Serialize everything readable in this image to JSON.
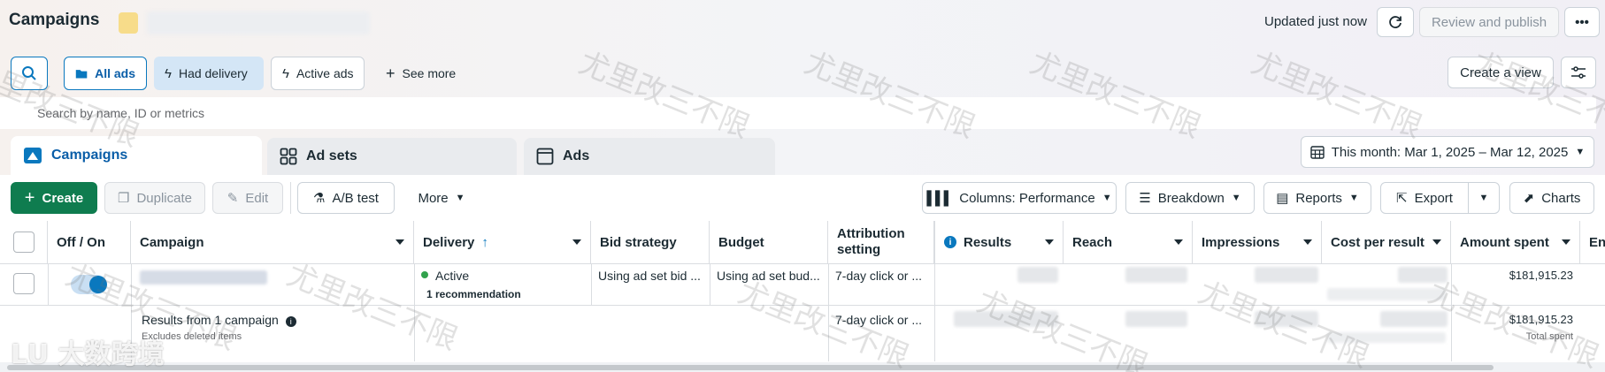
{
  "header": {
    "title": "Campaigns",
    "updated": "Updated just now",
    "review_label": "Review and publish",
    "more_icon": "ellipsis-icon"
  },
  "filters": {
    "all_ads": "All ads",
    "had_delivery": "Had delivery",
    "active_ads": "Active ads",
    "see_more": "See more",
    "create_view": "Create a view",
    "search_placeholder": "Search by name, ID or metrics"
  },
  "tabs": [
    {
      "label": "Campaigns",
      "selected": true
    },
    {
      "label": "Ad sets",
      "selected": false
    },
    {
      "label": "Ads",
      "selected": false
    }
  ],
  "date_range": "This month: Mar 1, 2025 – Mar 12, 2025",
  "toolbar": {
    "create": "Create",
    "duplicate": "Duplicate",
    "edit": "Edit",
    "ab_test": "A/B test",
    "more": "More",
    "columns": "Columns: Performance",
    "breakdown": "Breakdown",
    "reports": "Reports",
    "export": "Export",
    "charts": "Charts"
  },
  "table": {
    "headers": {
      "off_on": "Off / On",
      "campaign": "Campaign",
      "delivery": "Delivery",
      "bid_strategy": "Bid strategy",
      "budget": "Budget",
      "attribution": "Attribution setting",
      "results": "Results",
      "reach": "Reach",
      "impressions": "Impressions",
      "cost_per_result": "Cost per result",
      "amount_spent": "Amount spent",
      "ends": "En"
    },
    "row": {
      "toggle_on": true,
      "delivery_status": "Active",
      "recommendation": "1 recommendation",
      "bid_strategy": "Using ad set bid ...",
      "budget": "Using ad set bud...",
      "attribution": "7-day click or ...",
      "amount_spent": "$181,915.23"
    },
    "summary": {
      "label": "Results from 1 campaign",
      "sub": "Excludes deleted items",
      "attribution": "7-day click or ...",
      "amount_spent": "$181,915.23",
      "amount_sub": "Total spent"
    }
  },
  "watermark": {
    "text": "尤里改三不限",
    "logo_text": "大数跨境"
  },
  "colors": {
    "primary_blue": "#0a78be",
    "create_green": "#0f7c4f",
    "active_green": "#31a24c",
    "chip_selected_bg": "#d4e6f6"
  }
}
